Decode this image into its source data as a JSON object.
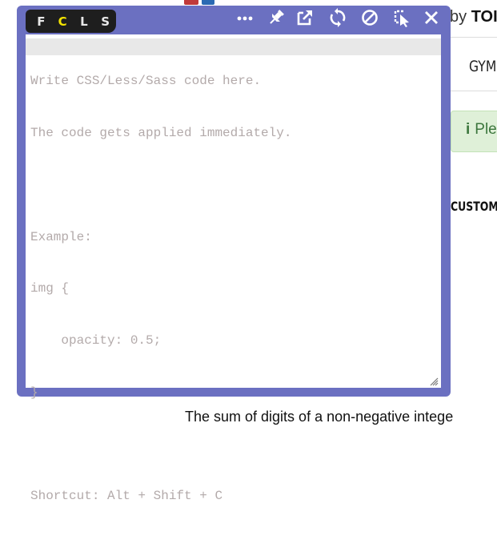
{
  "background_page": {
    "byline_prefix": "by ",
    "byline_name": "TOI",
    "nav_item": "GYM",
    "alert_icon": "info-icon",
    "alert_text": "Ple",
    "section_label": "CUSTOM",
    "body_sentence": "The sum of digits of a non-negative intege"
  },
  "editor_panel": {
    "tabs": [
      {
        "label": "F",
        "active": false
      },
      {
        "label": "C",
        "active": true
      },
      {
        "label": "L",
        "active": false
      },
      {
        "label": "S",
        "active": false
      }
    ],
    "toolbar": [
      {
        "icon": "more-icon"
      },
      {
        "icon": "pin-icon"
      },
      {
        "icon": "open-external-icon"
      },
      {
        "icon": "reload-icon"
      },
      {
        "icon": "disable-icon"
      },
      {
        "icon": "element-picker-icon"
      },
      {
        "icon": "close-icon"
      }
    ],
    "placeholder_lines": [
      "Write CSS/Less/Sass code here.",
      "The code gets applied immediately.",
      "",
      "Example:",
      "img {",
      "    opacity: 0.5;",
      "}",
      "",
      "Shortcut: Alt + Shift + C"
    ],
    "colors": {
      "panel_border": "#6b70c1",
      "active_tab": "#f4e400",
      "placeholder_text": "#b3aaaa"
    }
  }
}
